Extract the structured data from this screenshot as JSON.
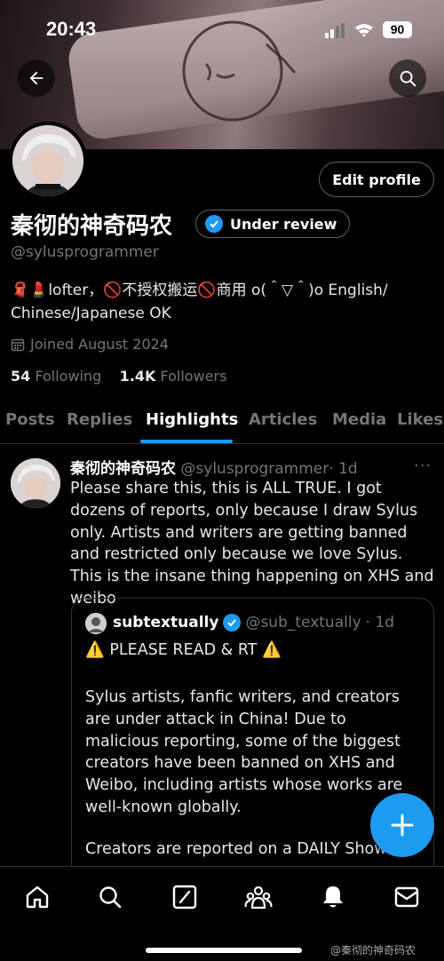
{
  "status_bar": {
    "time": "20:43",
    "battery": "90"
  },
  "header": {
    "edit_profile_label": "Edit profile"
  },
  "profile": {
    "name": "秦彻的神奇码农",
    "badge_label": "Under review",
    "handle": "@sylusprogrammer",
    "bio_line1": "🧣💄lofter，🚫不授权搬运🚫商用 o(＾▽＾)o English/",
    "bio_line2": "Chinese/Japanese OK",
    "joined": "Joined August 2024",
    "following_count": "54",
    "following_label": "Following",
    "followers_count": "1.4K",
    "followers_label": "Followers"
  },
  "tabs": [
    {
      "label": "Posts"
    },
    {
      "label": "Replies"
    },
    {
      "label": "Highlights"
    },
    {
      "label": "Articles"
    },
    {
      "label": "Media"
    },
    {
      "label": "Likes"
    }
  ],
  "tweet": {
    "author_name": "秦彻的神奇码农",
    "author_handle": "@sylusprogrammer",
    "time": "· 1d",
    "text": "Please share this, this is ALL TRUE. I got dozens of reports, only because I draw Sylus only. Artists and writers are getting banned and restricted only because we love Sylus. This is the insane thing happening on XHS and weibo",
    "quote": {
      "author_name": "subtextually",
      "author_handle": "@sub_textually",
      "time": "· 1d",
      "headline": "⚠️ PLEASE READ & RT ⚠️",
      "body": "Sylus artists, fanfic writers, and creators are under attack in China! Due to malicious reporting, some of the biggest creators have been banned on XHS and Weibo, including artists whose works are well-known globally.",
      "body2": "Creators are reported on a DAILY Show"
    }
  },
  "watermark": "@秦彻的神奇码农",
  "colors": {
    "accent": "#1d9bf0",
    "muted": "#71767b",
    "border": "#2f3336"
  },
  "icons": [
    "back-arrow-icon",
    "search-icon",
    "calendar-icon",
    "verified-badge-icon",
    "more-dots-icon",
    "compose-plus-icon",
    "home-icon",
    "explore-icon",
    "grok-icon",
    "communities-icon",
    "notifications-icon",
    "messages-icon"
  ]
}
